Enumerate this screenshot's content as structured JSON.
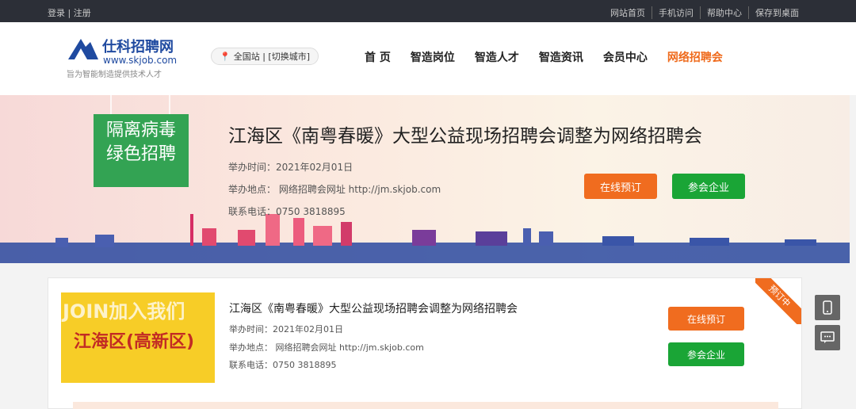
{
  "topbar": {
    "login": "登录 | 注册",
    "links": [
      "网站首页",
      "手机访问",
      "帮助中心",
      "保存到桌面"
    ]
  },
  "header": {
    "brand_cn": "仕科招聘网",
    "brand_url": "www.skjob.com",
    "tagline": "旨为智能制造提供技术人才",
    "city": "全国站 | [切换城市]",
    "nav": [
      "首 页",
      "智造岗位",
      "智造人才",
      "智造资讯",
      "会员中心",
      "网络招聘会"
    ]
  },
  "banner": {
    "sign": "隔离病毒\n绿色招聘",
    "title": "江海区《南粤春暖》大型公益现场招聘会调整为网络招聘会",
    "date": "举办时间：2021年02月01日",
    "place": "举办地点： 网络招聘会网址 http://jm.skjob.com",
    "phone": "联系电话：0750 3818895",
    "btn_book": "在线预订",
    "btn_companies": "参会企业"
  },
  "card": {
    "img_text1": "JOIN加入我们",
    "img_highlight": "江海区(高新区)",
    "title": "江海区《南粤春暖》大型公益现场招聘会调整为网络招聘会",
    "date": "举办时间：2021年02月01日",
    "place": "举办地点： 网络招聘会网址 http://jm.skjob.com",
    "phone": "联系电话：0750 3818895",
    "ribbon": "预订中",
    "btn_book": "在线预订",
    "btn_companies": "参会企业"
  },
  "side": {
    "phone_icon": "mobile-icon",
    "chat_icon": "message-icon"
  },
  "colors": {
    "accent": "#f06c1f",
    "green": "#1aa536",
    "topbar": "#2c2f37"
  }
}
